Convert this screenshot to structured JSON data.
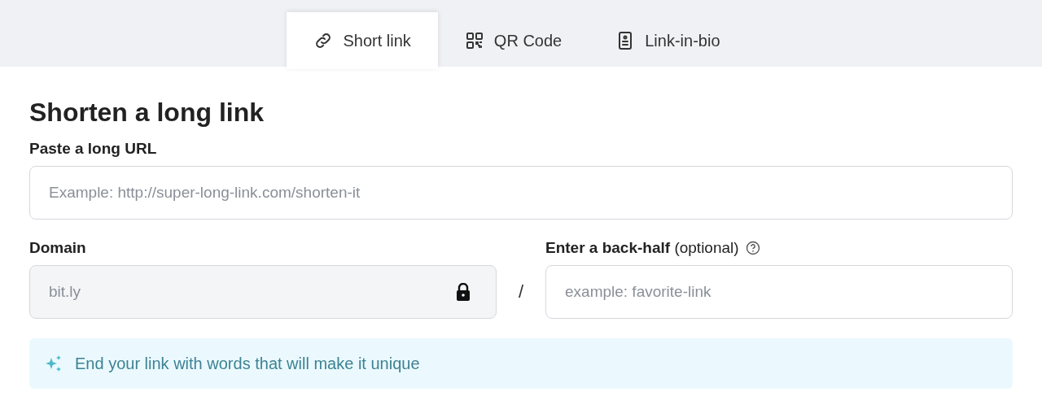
{
  "tabs": [
    {
      "label": "Short link",
      "selected": true
    },
    {
      "label": "QR Code",
      "selected": false
    },
    {
      "label": "Link-in-bio",
      "selected": false
    }
  ],
  "heading": "Shorten a long link",
  "url_field": {
    "label": "Paste a long URL",
    "placeholder": "Example: http://super-long-link.com/shorten-it"
  },
  "domain_field": {
    "label": "Domain",
    "value": "bit.ly",
    "disabled": true
  },
  "separator": "/",
  "back_half_field": {
    "label": "**Enter a back-half** (optional)",
    "placeholder": "example: favorite-link"
  },
  "tip": "End your link with words that will make it unique"
}
